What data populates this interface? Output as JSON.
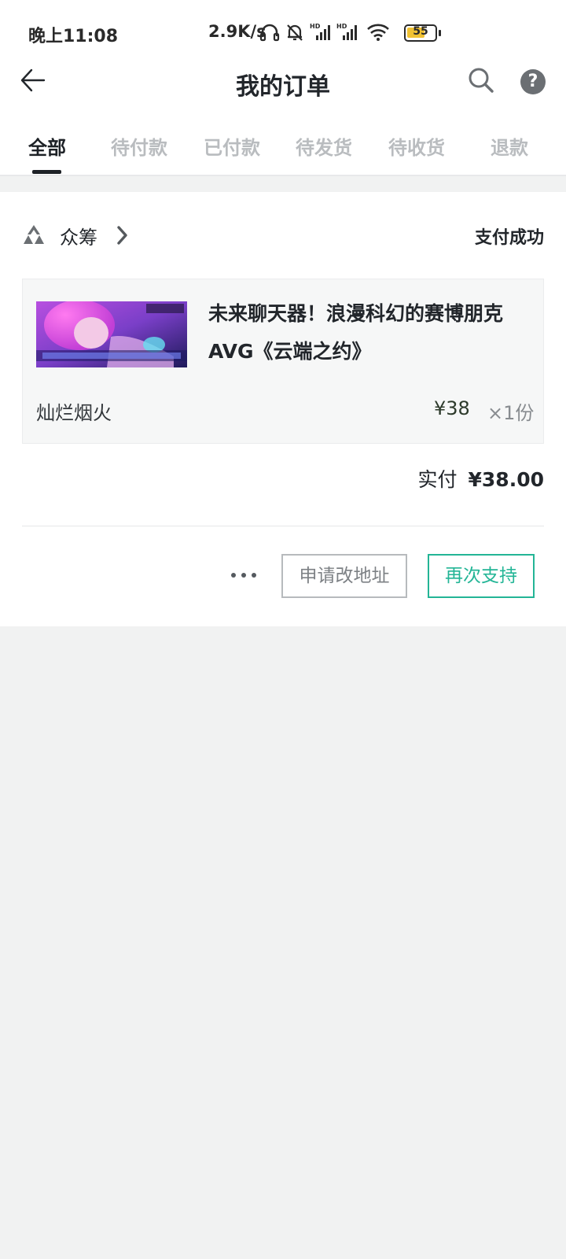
{
  "status_bar": {
    "time": "晚上11:08",
    "net_speed": "2.9K/s",
    "battery_level": "55",
    "icons": [
      "headphones-icon",
      "bell-muted-icon",
      "hd-signal-icon",
      "hd-signal-icon",
      "wifi-icon",
      "battery-icon"
    ]
  },
  "header": {
    "title": "我的订单",
    "back_icon": "back-arrow-icon",
    "search_icon": "search-icon",
    "help_label": "?"
  },
  "tabs": {
    "items": [
      {
        "label": "全部",
        "active": true
      },
      {
        "label": "待付款",
        "active": false
      },
      {
        "label": "已付款",
        "active": false
      },
      {
        "label": "待发货",
        "active": false
      },
      {
        "label": "待收货",
        "active": false
      },
      {
        "label": "退款",
        "active": false
      }
    ]
  },
  "order": {
    "store_name": "众筹",
    "status": "支付成功",
    "item": {
      "title_line1": "未来聊天器！浪漫科幻的赛博朋克",
      "title_line2": "AVG《云端之约》",
      "spec": "灿烂烟火",
      "price": "¥38",
      "quantity": "×1份"
    },
    "paid_label": "实付",
    "paid_amount": "¥38.00",
    "actions": {
      "more_icon": "more-dots-icon",
      "change_address": "申请改地址",
      "support_again": "再次支持"
    }
  },
  "colors": {
    "accent": "#23b596",
    "text_primary": "#22262b",
    "tab_inactive": "#b9bcbf",
    "page_bg": "#f1f2f2",
    "battery_fill": "#f1c232"
  }
}
